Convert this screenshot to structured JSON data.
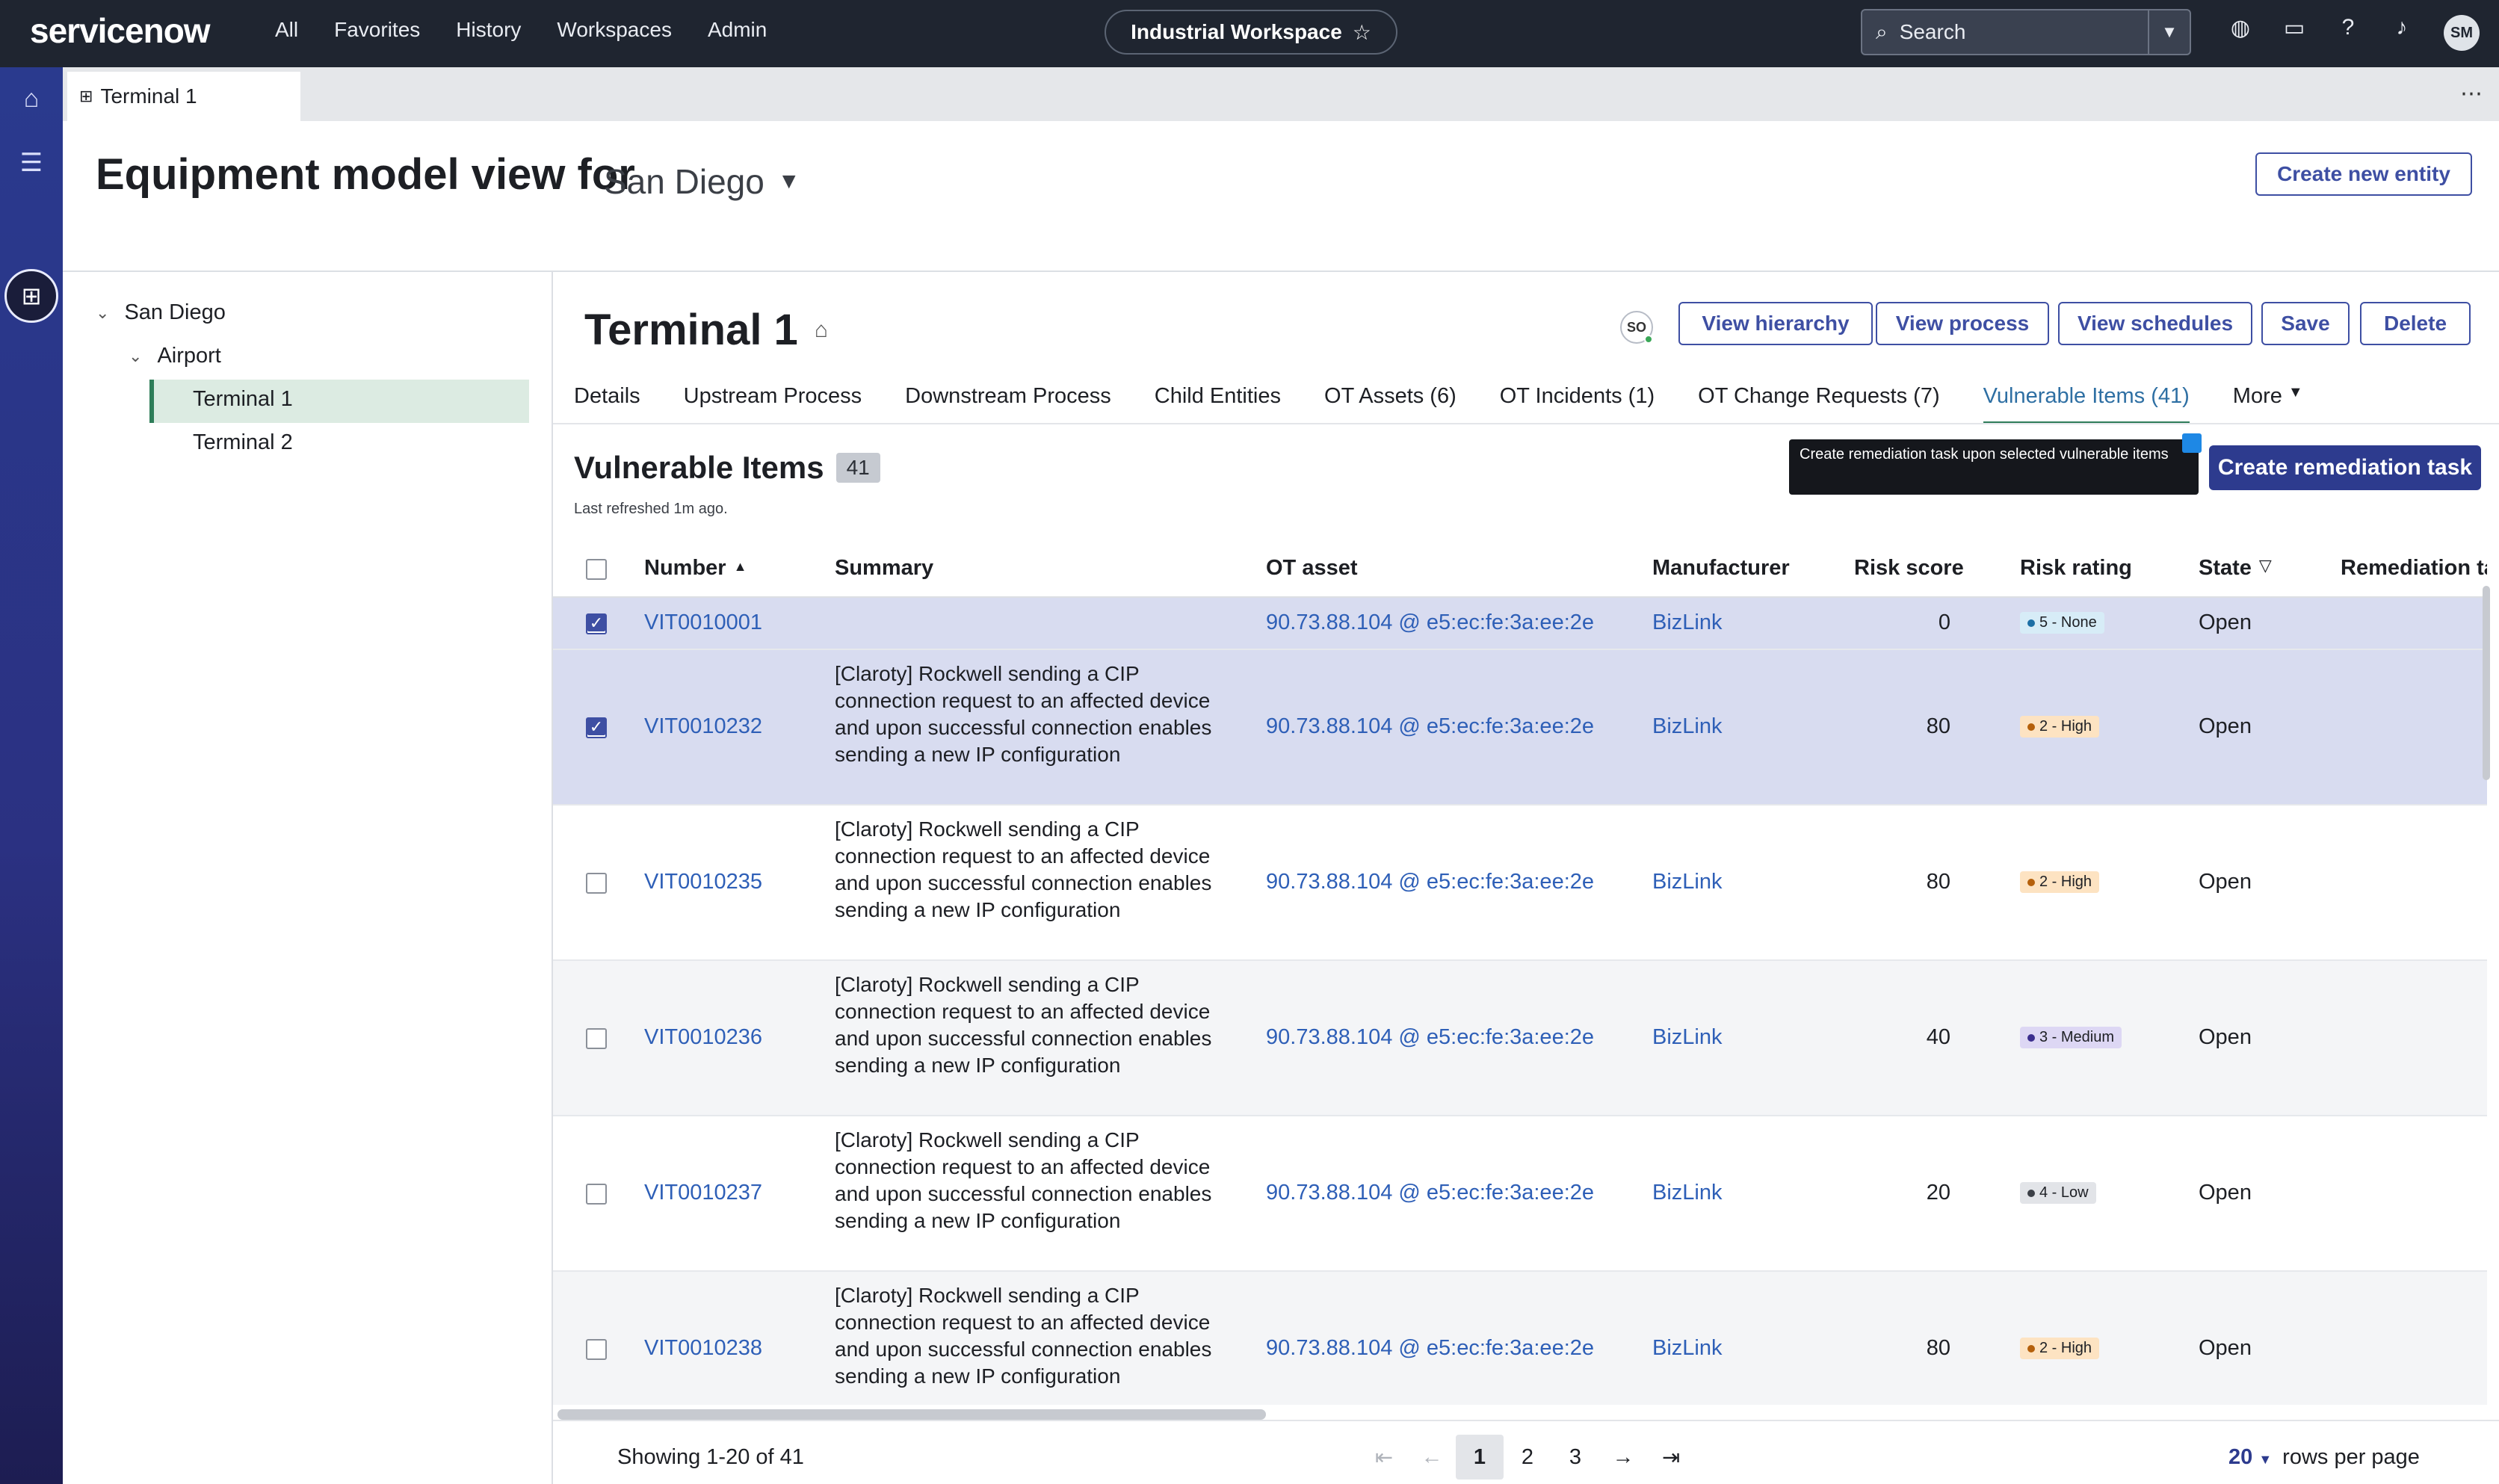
{
  "topnav": {
    "logo": "servicenow",
    "links": [
      "All",
      "Favorites",
      "History",
      "Workspaces",
      "Admin"
    ],
    "workspace": "Industrial Workspace",
    "search_placeholder": "Search",
    "avatar_initials": "SM"
  },
  "tabs": {
    "active": "Terminal 1"
  },
  "header": {
    "title": "Equipment model view for",
    "location": "San Diego",
    "create_button": "Create new entity"
  },
  "tree": {
    "root": "San Diego",
    "child": "Airport",
    "leaves": [
      "Terminal 1",
      "Terminal 2"
    ]
  },
  "entity": {
    "title": "Terminal 1",
    "user_badge": "SO",
    "actions": [
      "View hierarchy",
      "View process",
      "View schedules",
      "Save",
      "Delete"
    ],
    "subtabs": [
      "Details",
      "Upstream Process",
      "Downstream Process",
      "Child Entities",
      "OT Assets (6)",
      "OT Incidents (1)",
      "OT Change Requests (7)",
      "Vulnerable Items (41)",
      "More"
    ]
  },
  "list": {
    "title": "Vulnerable Items",
    "count": "41",
    "refreshed": "Last refreshed 1m ago.",
    "tooltip": "Create remediation task upon selected vulnerable items",
    "primary_button": "Create remediation task",
    "columns": {
      "number": "Number",
      "summary": "Summary",
      "ot_asset": "OT asset",
      "manufacturer": "Manufacturer",
      "risk_score": "Risk score",
      "risk_rating": "Risk rating",
      "state": "State",
      "remediation": "Remediation ta"
    },
    "rows": [
      {
        "number": "VIT0010001",
        "summary": "",
        "ot_asset": "90.73.88.104 @ e5:ec:fe:3a:ee:2e",
        "manufacturer": "BizLink",
        "risk_score": "0",
        "risk_rating": "5 - None",
        "state": "Open",
        "checked": true
      },
      {
        "number": "VIT0010232",
        "summary": "[Claroty] Rockwell sending a CIP connection request to an affected device and upon successful connection enables sending a new IP configuration",
        "ot_asset": "90.73.88.104 @ e5:ec:fe:3a:ee:2e",
        "manufacturer": "BizLink",
        "risk_score": "80",
        "risk_rating": "2 - High",
        "state": "Open",
        "checked": true
      },
      {
        "number": "VIT0010235",
        "summary": "[Claroty] Rockwell sending a CIP connection request to an affected device and upon successful connection enables sending a new IP configuration",
        "ot_asset": "90.73.88.104 @ e5:ec:fe:3a:ee:2e",
        "manufacturer": "BizLink",
        "risk_score": "80",
        "risk_rating": "2 - High",
        "state": "Open",
        "checked": false
      },
      {
        "number": "VIT0010236",
        "summary": "[Claroty] Rockwell sending a CIP connection request to an affected device and upon successful connection enables sending a new IP configuration",
        "ot_asset": "90.73.88.104 @ e5:ec:fe:3a:ee:2e",
        "manufacturer": "BizLink",
        "risk_score": "40",
        "risk_rating": "3 - Medium",
        "state": "Open",
        "checked": false
      },
      {
        "number": "VIT0010237",
        "summary": "[Claroty] Rockwell sending a CIP connection request to an affected device and upon successful connection enables sending a new IP configuration",
        "ot_asset": "90.73.88.104 @ e5:ec:fe:3a:ee:2e",
        "manufacturer": "BizLink",
        "risk_score": "20",
        "risk_rating": "4 - Low",
        "state": "Open",
        "checked": false
      },
      {
        "number": "VIT0010238",
        "summary": "[Claroty] Rockwell sending a CIP connection request to an affected device and upon successful connection enables sending a new IP configuration",
        "ot_asset": "90.73.88.104 @ e5:ec:fe:3a:ee:2e",
        "manufacturer": "BizLink",
        "risk_score": "80",
        "risk_rating": "2 - High",
        "state": "Open",
        "checked": false
      }
    ]
  },
  "rating_colors": {
    "5 - None": {
      "bg": "#d7ecf7",
      "dot": "#1d6fa5"
    },
    "2 - High": {
      "bg": "#fde3c2",
      "dot": "#b5600b"
    },
    "3 - Medium": {
      "bg": "#ddd7f4",
      "dot": "#3b2e8e"
    },
    "4 - Low": {
      "bg": "#e2e4e8",
      "dot": "#3b3f46"
    }
  },
  "footer": {
    "showing": "Showing 1-20 of 41",
    "pages": [
      "1",
      "2",
      "3"
    ],
    "current_page": "1",
    "rows_per_page_value": "20",
    "rows_per_page_label": "rows per page"
  },
  "colors": {
    "accent": "#3e4fa3",
    "nav_bg": "#1f2530",
    "selected_row": "#d8dcf0"
  }
}
